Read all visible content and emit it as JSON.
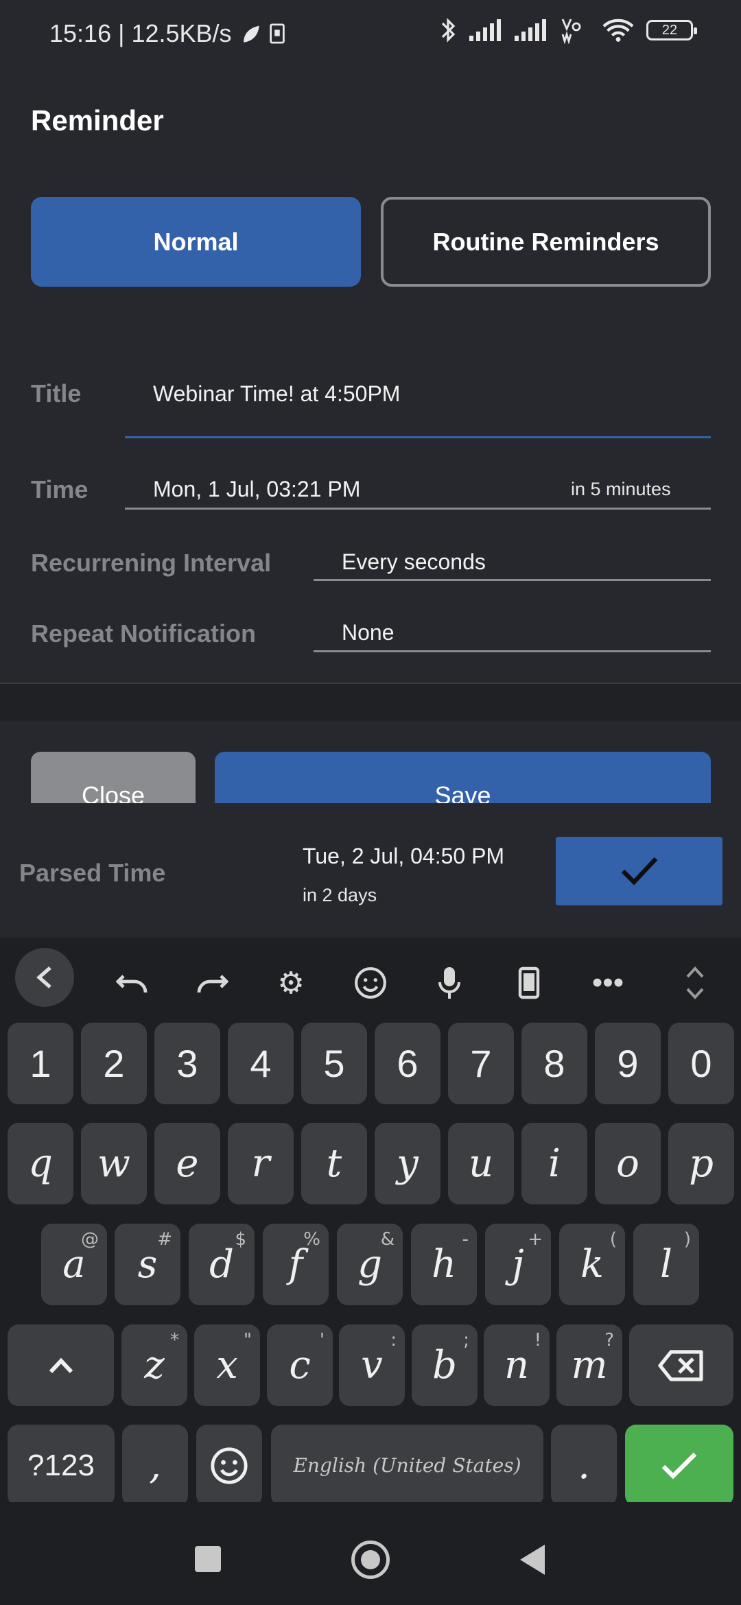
{
  "status_bar": {
    "time": "15:16",
    "separator": "|",
    "speed": "12.5KB/s",
    "battery": "22"
  },
  "header": {
    "title": "Reminder"
  },
  "mode_tabs": {
    "normal": "Normal",
    "routine": "Routine Reminders"
  },
  "form": {
    "title_label": "Title",
    "title_value": "Webinar Time! at 4:50PM",
    "time_label": "Time",
    "time_value": "Mon, 1 Jul, 03:21 PM",
    "time_relative": "in 5 minutes",
    "interval_label": "Recurrening Interval",
    "interval_value": "Every seconds",
    "repeat_label": "Repeat Notification",
    "repeat_value": "None"
  },
  "actions": {
    "close": "Close",
    "save": "Save"
  },
  "parsed": {
    "label": "Parsed Time",
    "time": "Tue, 2 Jul, 04:50 PM",
    "relative": "in 2 days"
  },
  "keyboard": {
    "numbers": [
      "1",
      "2",
      "3",
      "4",
      "5",
      "6",
      "7",
      "8",
      "9",
      "0"
    ],
    "row1": [
      "q",
      "w",
      "e",
      "r",
      "t",
      "y",
      "u",
      "i",
      "o",
      "p"
    ],
    "row2": [
      "a",
      "s",
      "d",
      "f",
      "g",
      "h",
      "j",
      "k",
      "l"
    ],
    "row2_hints": [
      "@",
      "#",
      "$",
      "%",
      "&",
      "-",
      "+",
      "(",
      ")"
    ],
    "row3": [
      "z",
      "x",
      "c",
      "v",
      "b",
      "n",
      "m"
    ],
    "row3_hints": [
      "*",
      "\"",
      "'",
      ":",
      ";",
      "!",
      "?"
    ],
    "symbols_key": "?123",
    "comma": ",",
    "space": "English (United States)",
    "period": "."
  },
  "colors": {
    "accent": "#3462aa",
    "enter": "#4caf50",
    "background": "#27282d"
  }
}
